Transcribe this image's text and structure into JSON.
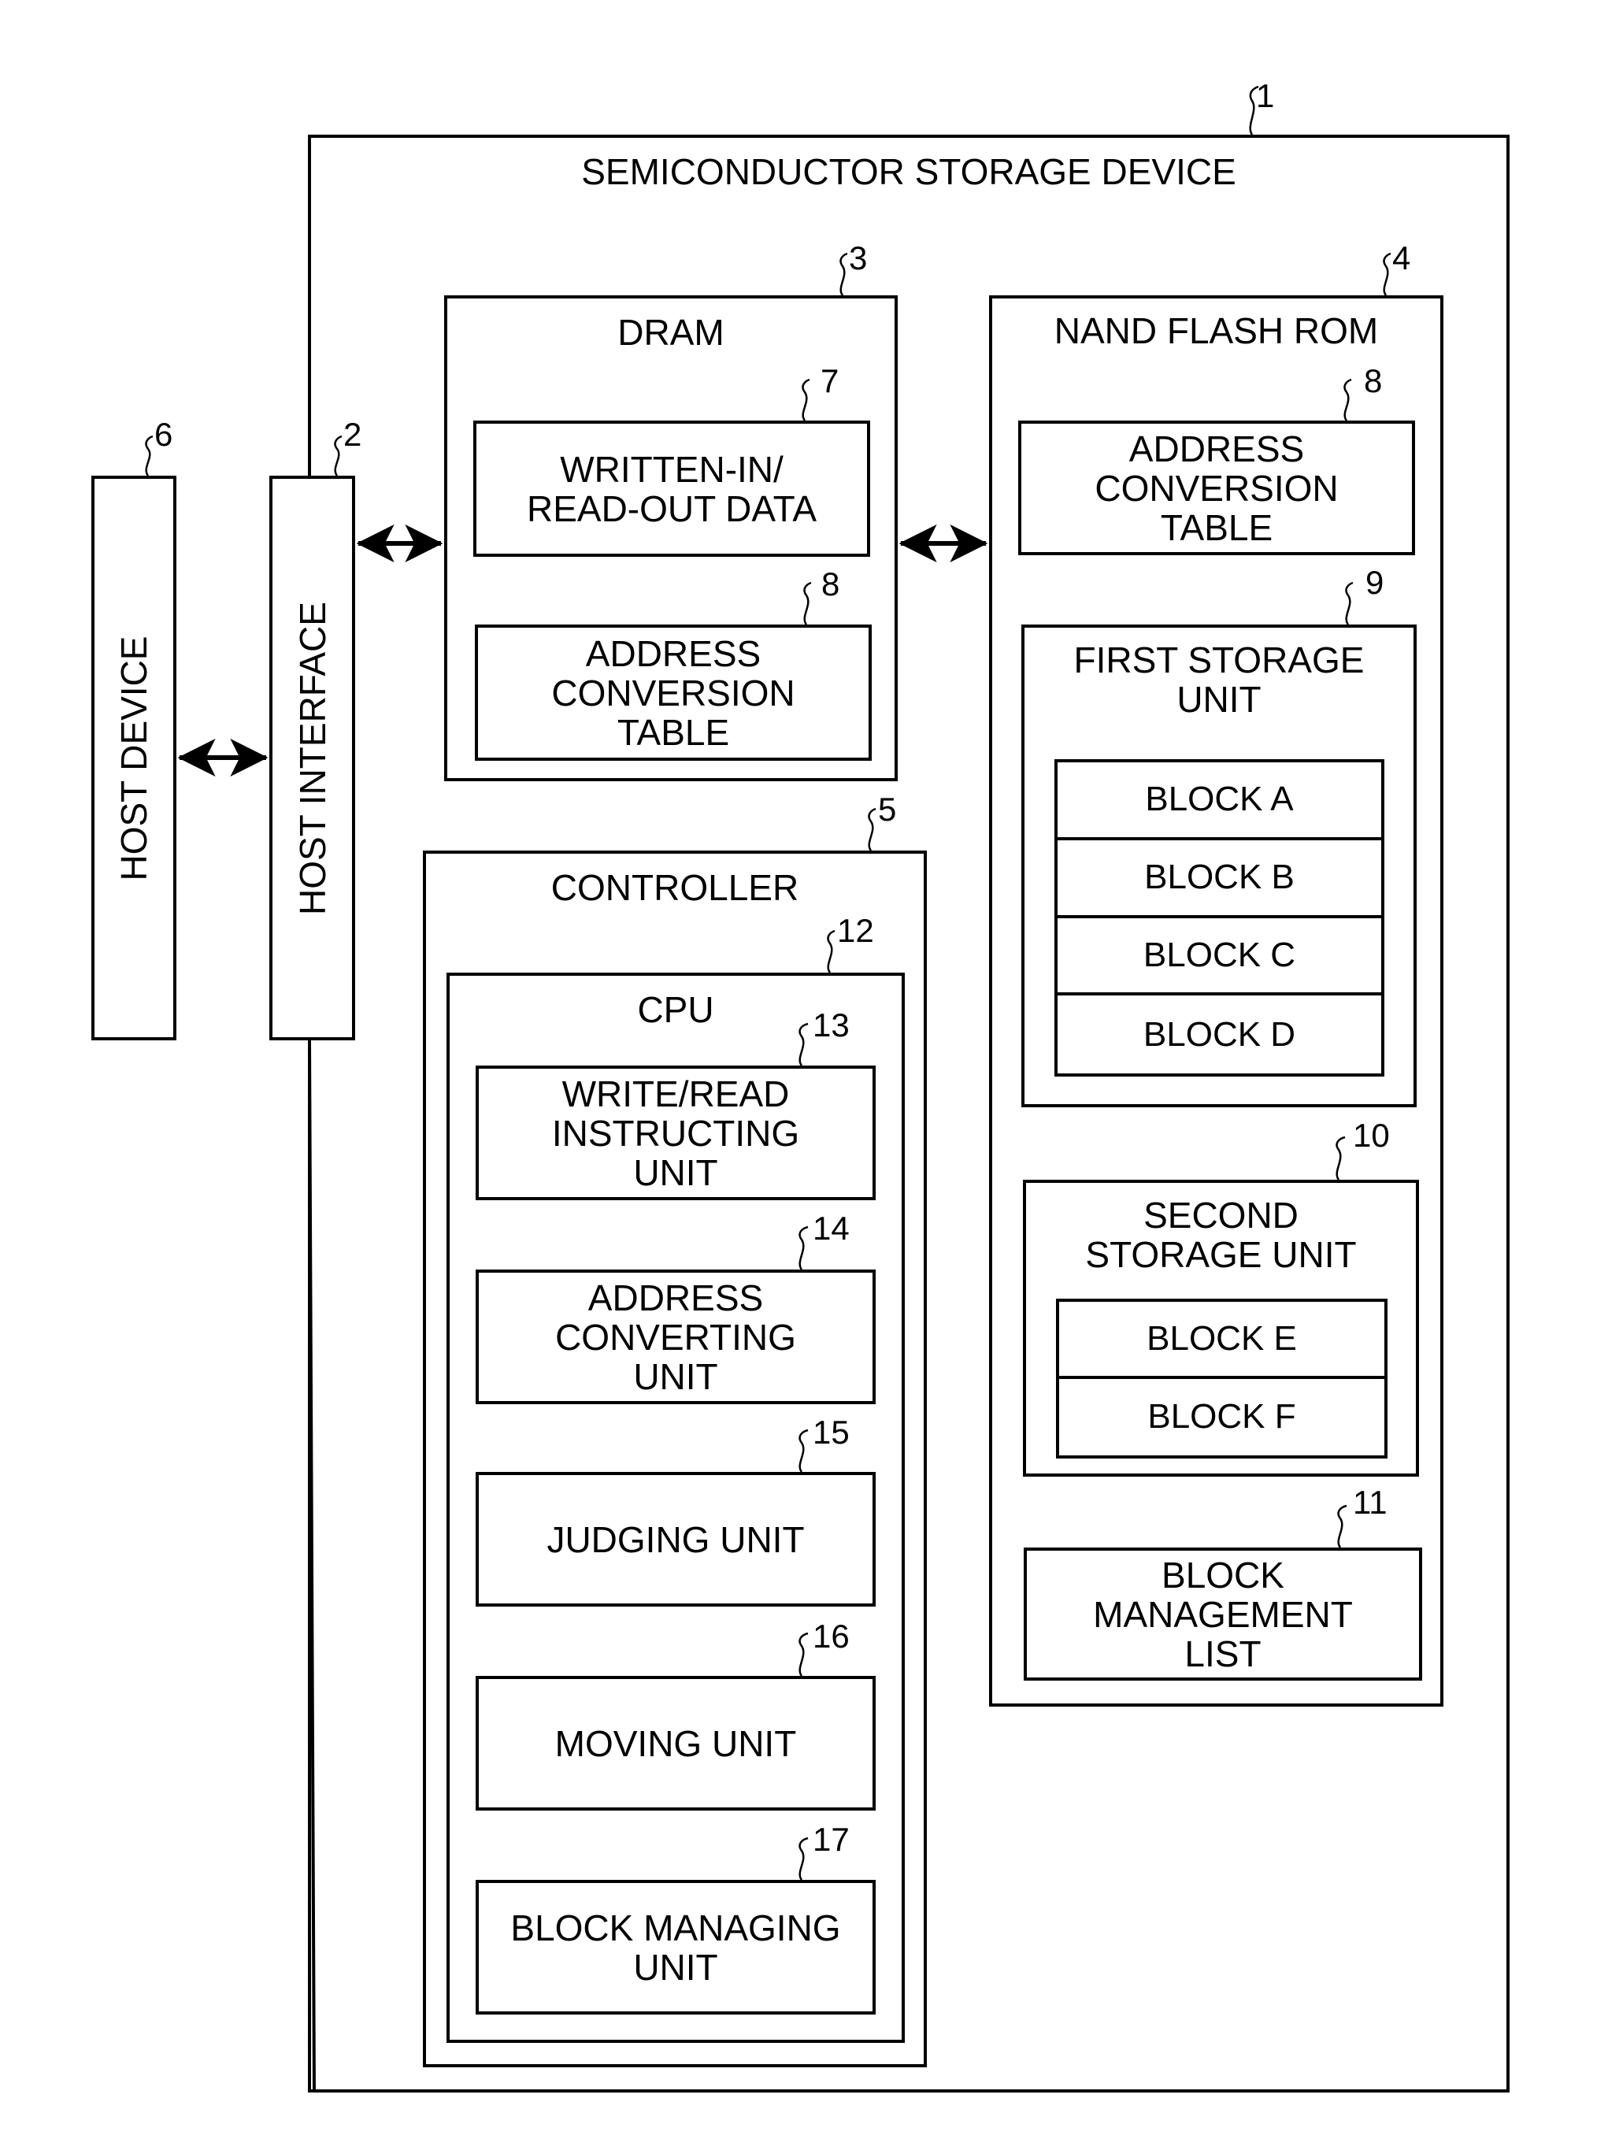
{
  "diagram": {
    "device": {
      "ref": "1",
      "label": "SEMICONDUCTOR STORAGE DEVICE"
    },
    "host_device": {
      "ref": "6",
      "label": "HOST DEVICE"
    },
    "host_interface": {
      "ref": "2",
      "label": "HOST INTERFACE"
    },
    "dram": {
      "ref": "3",
      "label": "DRAM",
      "data": {
        "ref": "7",
        "label": "WRITTEN-IN/\nREAD-OUT DATA"
      },
      "table": {
        "ref": "8",
        "label": "ADDRESS\nCONVERSION\nTABLE"
      }
    },
    "nand": {
      "ref": "4",
      "label": "NAND FLASH ROM",
      "table": {
        "ref": "8",
        "label": "ADDRESS\nCONVERSION\nTABLE"
      },
      "first_storage": {
        "ref": "9",
        "label": "FIRST STORAGE\nUNIT",
        "blocks": [
          "BLOCK A",
          "BLOCK B",
          "BLOCK C",
          "BLOCK D"
        ]
      },
      "second_storage": {
        "ref": "10",
        "label": "SECOND\nSTORAGE UNIT",
        "blocks": [
          "BLOCK E",
          "BLOCK F"
        ]
      },
      "block_list": {
        "ref": "11",
        "label": "BLOCK\nMANAGEMENT\nLIST"
      }
    },
    "controller": {
      "ref": "5",
      "label": "CONTROLLER",
      "cpu": {
        "ref": "12",
        "label": "CPU",
        "units": [
          {
            "ref": "13",
            "label": "WRITE/READ\nINSTRUCTING\nUNIT"
          },
          {
            "ref": "14",
            "label": "ADDRESS\nCONVERTING\nUNIT"
          },
          {
            "ref": "15",
            "label": "JUDGING UNIT"
          },
          {
            "ref": "16",
            "label": "MOVING UNIT"
          },
          {
            "ref": "17",
            "label": "BLOCK MANAGING\nUNIT"
          }
        ]
      }
    }
  }
}
